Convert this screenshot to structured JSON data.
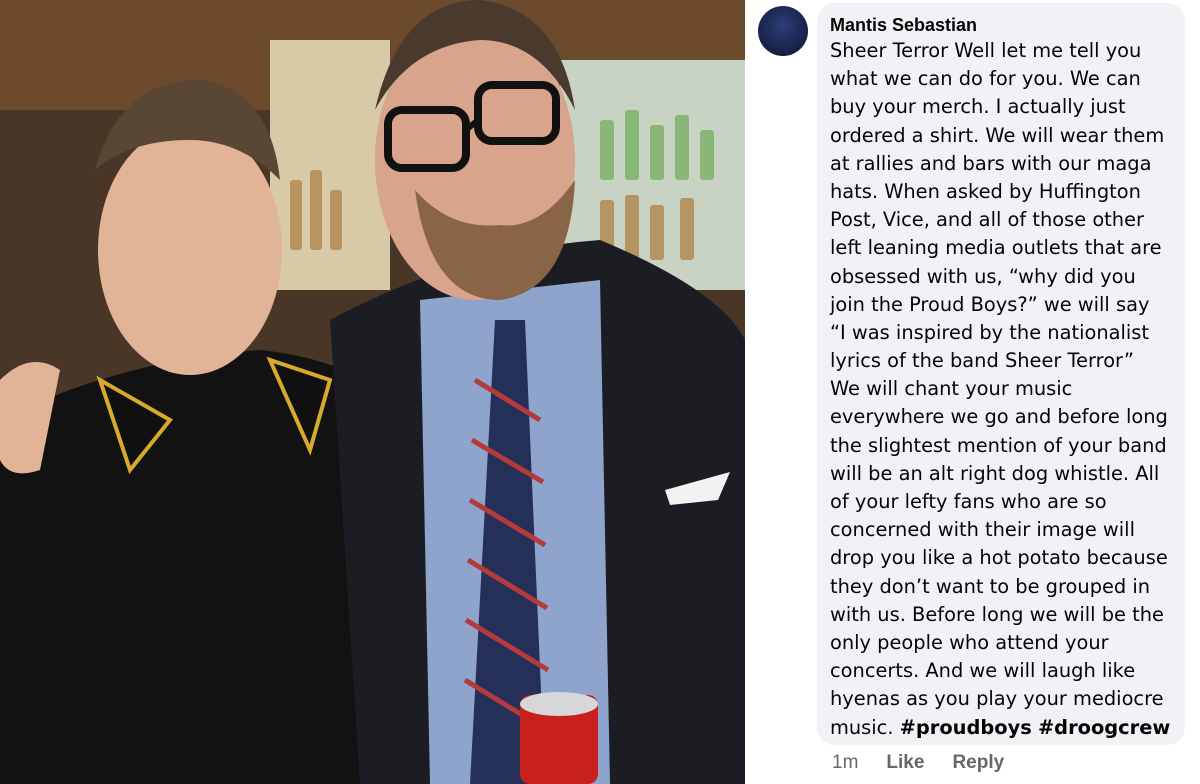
{
  "photo": {
    "description_icon": "photo-image"
  },
  "comment": {
    "avatar_icon": "profile-avatar",
    "author": "Mantis Sebastian",
    "lines": [
      "Sheer Terror  Well let me tell you",
      "what we can do for you. We can",
      "buy your merch. I actually just",
      "ordered a shirt. We will wear them",
      "at rallies and bars with our maga",
      "hats. When asked by Huffington",
      "Post, Vice, and all of those other",
      "left leaning media outlets that are",
      "obsessed with us, “why did you",
      "join the Proud Boys?” we will say",
      "“I was inspired by the nationalist",
      "lyrics of the band Sheer Terror”",
      "We will chant your music",
      "everywhere we go and before long",
      "the slightest mention of your band",
      "will be an alt right dog whistle. All",
      "of your lefty fans who are so",
      "concerned with their image will",
      "drop you like a hot potato because",
      "they don’t want to be grouped in",
      "with us. Before long we will be the",
      "only people who attend your",
      "concerts. And we will laugh like",
      "hyenas as you play your mediocre"
    ],
    "last_line_prefix": "music. ",
    "hashtags": [
      "#proudboys",
      "#droogcrew"
    ]
  },
  "actions": {
    "time": "1m",
    "like_label": "Like",
    "reply_label": "Reply"
  },
  "colors": {
    "bubble": "#f0f2f5",
    "text": "#050505",
    "meta": "#65676b"
  }
}
